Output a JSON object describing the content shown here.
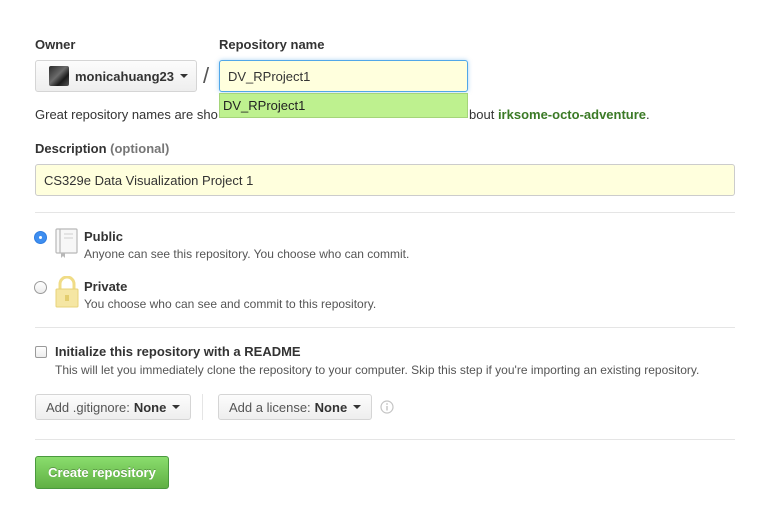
{
  "owner": {
    "label": "Owner",
    "username": "monicahuang23"
  },
  "repo_name": {
    "label": "Repository name",
    "value": "DV_RProject1",
    "autocomplete_suggestion": "DV_RProject1",
    "hint_start": "Great repository names are sho",
    "hint_end": "bout",
    "hint_example": "irksome-octo-adventure",
    "hint_tail": "."
  },
  "slash": "/",
  "description": {
    "label": "Description",
    "optional": "(optional)",
    "value": "CS329e Data Visualization Project 1"
  },
  "visibility": {
    "selected": "public",
    "public": {
      "title": "Public",
      "desc": "Anyone can see this repository. You choose who can commit."
    },
    "private": {
      "title": "Private",
      "desc": "You choose who can see and commit to this repository."
    }
  },
  "readme": {
    "checked": false,
    "title": "Initialize this repository with a README",
    "desc": "This will let you immediately clone the repository to your computer. Skip this step if you're importing an existing repository."
  },
  "gitignore": {
    "label": "Add .gitignore:",
    "value": "None"
  },
  "license": {
    "label": "Add a license:",
    "value": "None"
  },
  "info_icon": "info-icon",
  "submit_label": "Create repository",
  "colors": {
    "accent_green": "#60b044",
    "autofill_yellow": "#ffffdd",
    "suggestion_green": "#bef18f",
    "radio_blue": "#3e8ef0"
  }
}
